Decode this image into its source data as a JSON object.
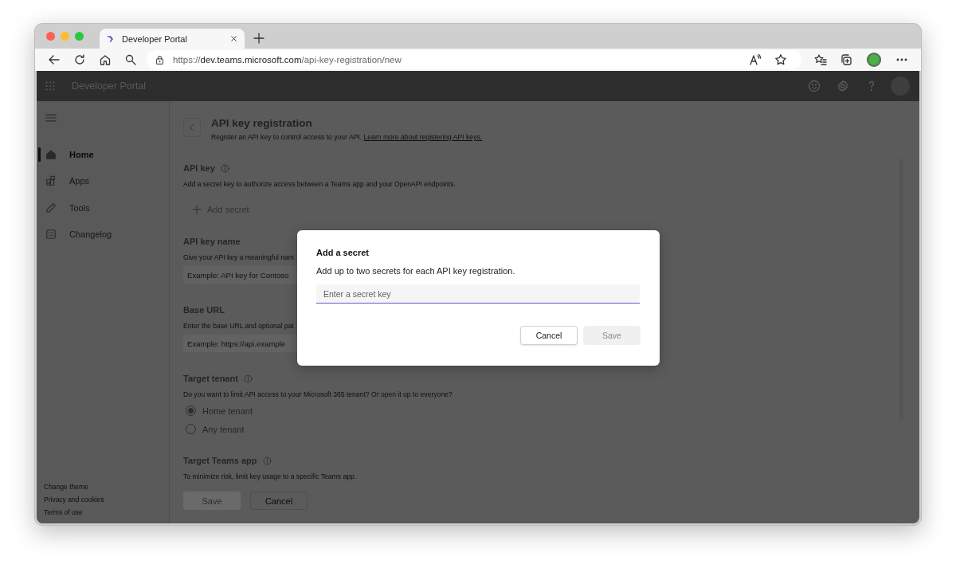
{
  "browser": {
    "tabs": [
      {
        "title": "Developer Portal",
        "selected": true
      }
    ],
    "url": {
      "scheme": "https://",
      "host": "dev.teams.microsoft.com",
      "path": "/api-key-registration/new"
    }
  },
  "app": {
    "title": "Developer Portal",
    "sidebar": {
      "items": [
        {
          "label": "Home",
          "selected": true
        },
        {
          "label": "Apps",
          "selected": false
        },
        {
          "label": "Tools",
          "selected": false
        },
        {
          "label": "Changelog",
          "selected": false
        }
      ],
      "footer_links": [
        "Change theme",
        "Privacy and cookies",
        "Terms of use"
      ]
    }
  },
  "page": {
    "title": "API key registration",
    "subtitle": "Register an API key to control access to your API.",
    "subtitle_link": "Learn more about registering API keys.",
    "sections": [
      {
        "kind": "action",
        "label": "API key",
        "info": true,
        "description": "Add a secret key to authorize access between a Teams app and your OpenAPI endpoints.",
        "action": "Add secret"
      },
      {
        "kind": "input",
        "label": "API key name",
        "info": false,
        "description": "Give your API key a meaningful nam",
        "placeholder": "Example: API key for Contoso"
      },
      {
        "kind": "input",
        "label": "Base URL",
        "info": false,
        "description": "Enter the base URL and optional pat",
        "placeholder": "Example: https://api.example"
      },
      {
        "kind": "radio",
        "label": "Target tenant",
        "info": true,
        "description": "Do you want to limit API access to your Microsoft 365 tenant? Or open it up to everyone?",
        "options": [
          {
            "label": "Home tenant",
            "selected": true
          },
          {
            "label": "Any tenant",
            "selected": false
          }
        ]
      },
      {
        "kind": "text",
        "label": "Target Teams app",
        "info": true,
        "description": "To minimize risk, limit key usage to a specific Teams app."
      }
    ],
    "buttons": [
      {
        "label": "Save",
        "kind": "primary",
        "disabled": true
      },
      {
        "label": "Cancel",
        "kind": "secondary",
        "disabled": false
      }
    ]
  },
  "dialog": {
    "title": "Add a secret",
    "description": "Add up to two secrets for each API key registration.",
    "placeholder": "Enter a secret key",
    "buttons": [
      {
        "label": "Cancel",
        "kind": "secondary",
        "disabled": false
      },
      {
        "label": "Save",
        "kind": "primary",
        "disabled": true
      }
    ]
  }
}
